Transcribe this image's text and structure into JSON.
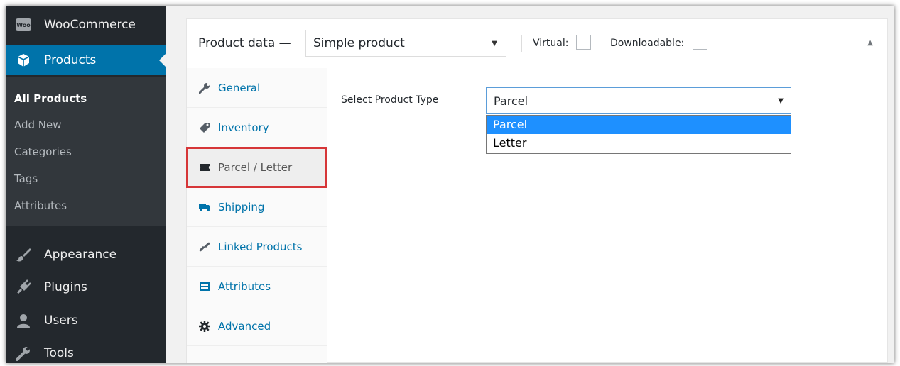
{
  "sidebar": {
    "woocommerce": {
      "label": "WooCommerce",
      "badge": "Woo",
      "icon": "woo-icon"
    },
    "products": {
      "label": "Products",
      "icon": "box-icon"
    },
    "submenu": [
      "All Products",
      "Add New",
      "Categories",
      "Tags",
      "Attributes"
    ],
    "current_submenu": "All Products",
    "bottom_items": [
      {
        "label": "Appearance",
        "icon": "paintbrush-icon"
      },
      {
        "label": "Plugins",
        "icon": "plugin-icon"
      },
      {
        "label": "Users",
        "icon": "user-icon"
      },
      {
        "label": "Tools",
        "icon": "wrench-icon"
      }
    ]
  },
  "product_data": {
    "title": "Product data —",
    "product_type": "Simple product",
    "virtual_label": "Virtual:",
    "downloadable_label": "Downloadable:",
    "virtual_checked": false,
    "downloadable_checked": false
  },
  "tabs": [
    {
      "label": "General",
      "icon": "wrench-icon"
    },
    {
      "label": "Inventory",
      "icon": "tag-icon"
    },
    {
      "label": "Parcel / Letter",
      "icon": "ticket-icon",
      "active": true,
      "highlighted": true
    },
    {
      "label": "Shipping",
      "icon": "truck-icon"
    },
    {
      "label": "Linked Products",
      "icon": "link-icon"
    },
    {
      "label": "Attributes",
      "icon": "list-icon"
    },
    {
      "label": "Advanced",
      "icon": "gear-icon"
    }
  ],
  "panel": {
    "field_label": "Select Product Type",
    "selected_value": "Parcel",
    "options": [
      "Parcel",
      "Letter"
    ],
    "highlighted_option": "Parcel"
  },
  "colors": {
    "sidebar_bg": "#23282d",
    "submenu_bg": "#32373c",
    "accent": "#0073aa",
    "highlight_border": "#d63638",
    "dropdown_selected": "#1e90ff"
  }
}
